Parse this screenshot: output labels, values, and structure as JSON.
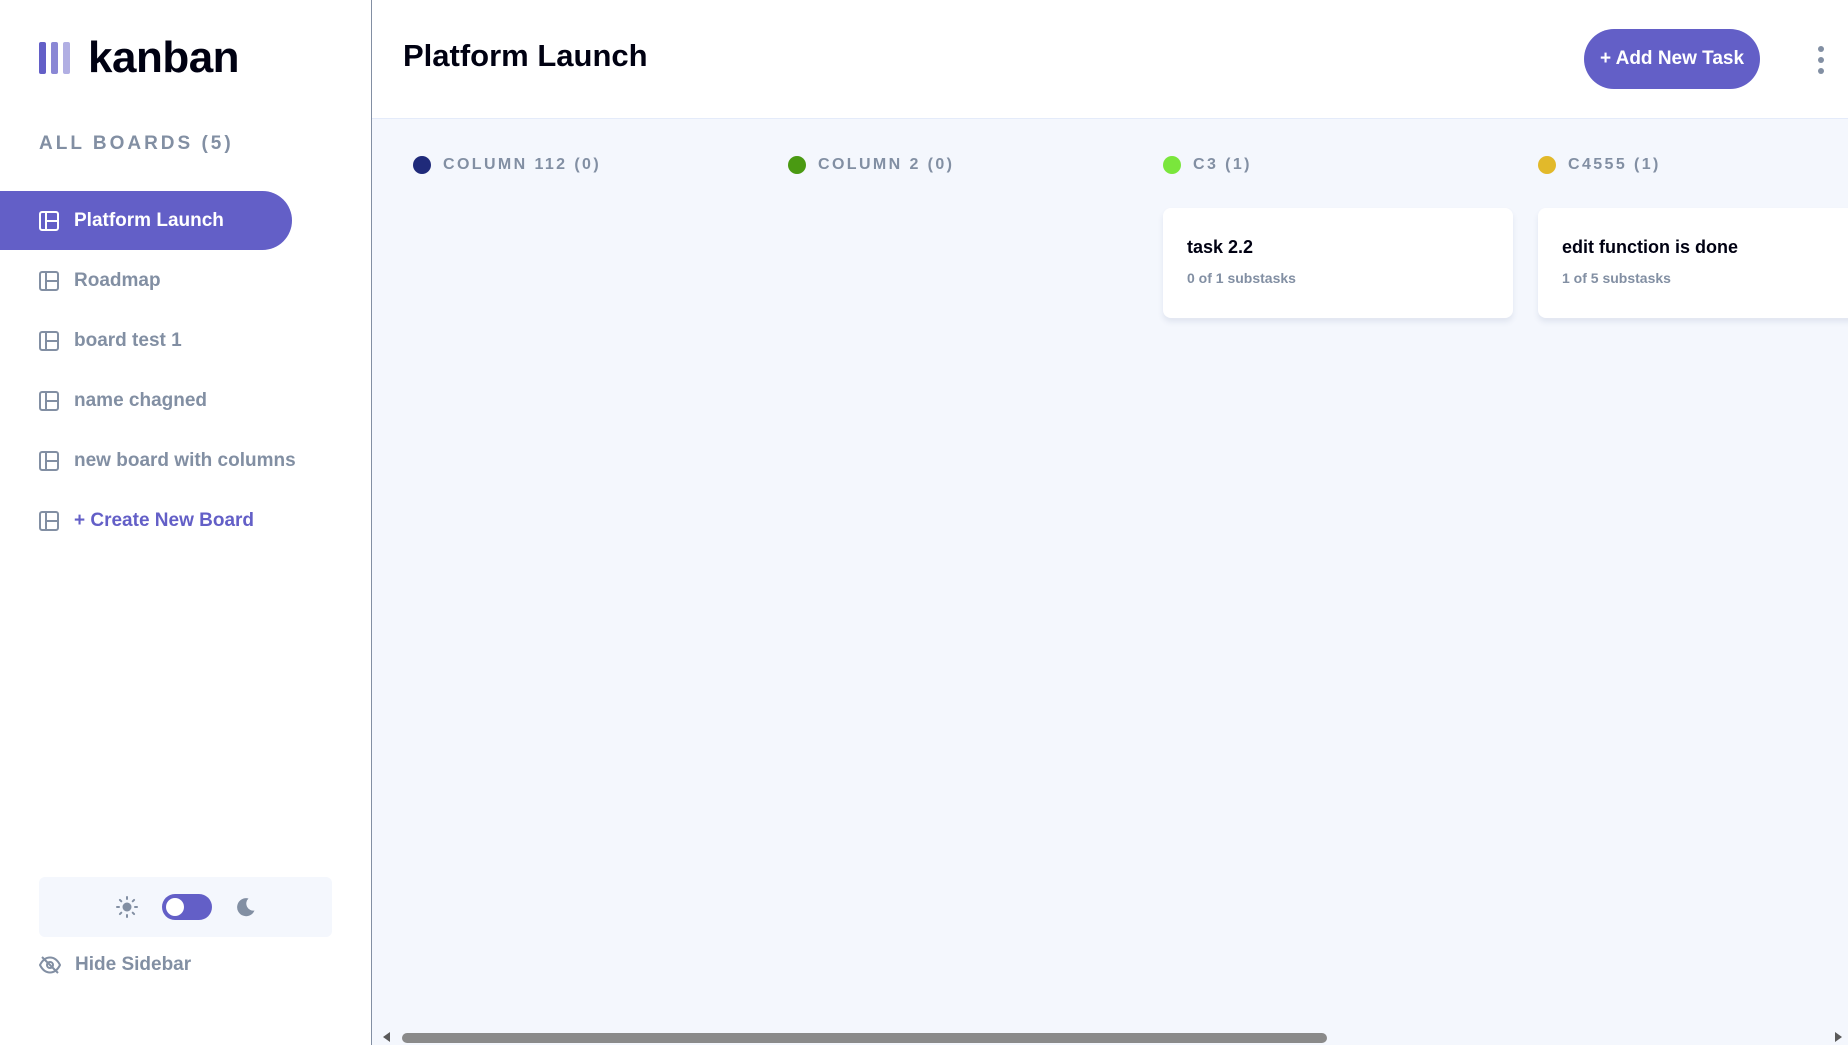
{
  "app": {
    "logo_text": "kanban",
    "brand_color": "#635FC7"
  },
  "sidebar": {
    "boards_heading": "ALL BOARDS (5)",
    "items": [
      {
        "label": "Platform Launch",
        "active": true
      },
      {
        "label": "Roadmap",
        "active": false
      },
      {
        "label": "board test 1",
        "active": false
      },
      {
        "label": "name chagned",
        "active": false
      },
      {
        "label": "new board with columns",
        "active": false
      }
    ],
    "create_label": "+ Create New Board",
    "theme": {
      "mode": "light"
    },
    "hide_label": "Hide Sidebar"
  },
  "header": {
    "title": "Platform Launch",
    "add_task_label": "+ Add New Task"
  },
  "columns": [
    {
      "label": "COLUMN 112 (0)",
      "color": "#1F2A7A",
      "tasks": []
    },
    {
      "label": "COLUMN 2 (0)",
      "color": "#4A9A12",
      "tasks": []
    },
    {
      "label": "C3 (1)",
      "color": "#7AE63C",
      "tasks": [
        {
          "title": "task 2.2",
          "subtasks": "0 of 1 substasks"
        }
      ]
    },
    {
      "label": "C4555 (1)",
      "color": "#E2B92A",
      "tasks": [
        {
          "title": "edit function is done",
          "subtasks": "1 of 5 substasks"
        }
      ]
    }
  ]
}
